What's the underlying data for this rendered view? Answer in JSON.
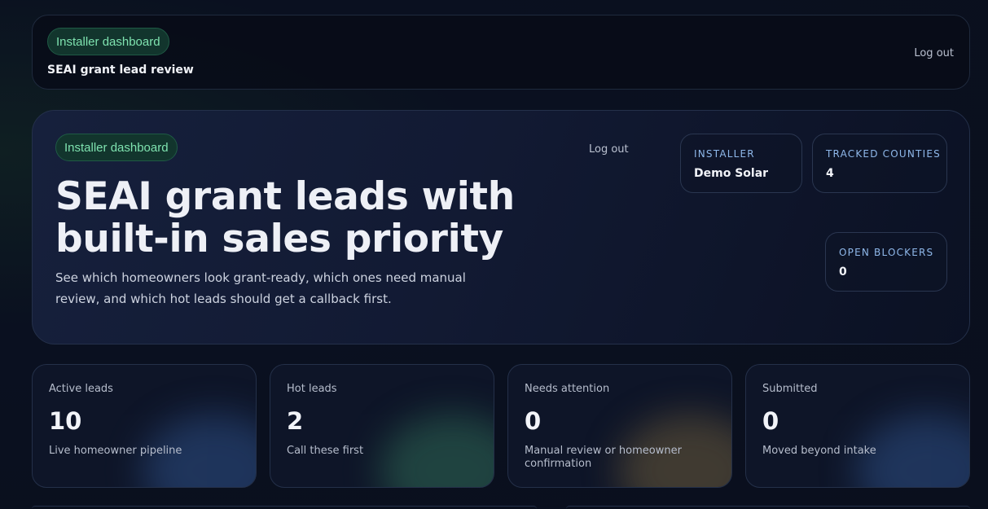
{
  "topbar": {
    "badge": "Installer dashboard",
    "subtitle": "SEAI grant lead review",
    "logout": "Log out"
  },
  "hero": {
    "badge": "Installer dashboard",
    "logout": "Log out",
    "title": "SEAI grant leads with built-in sales priority",
    "description": "See which homeowners look grant-ready, which ones need manual review, and which hot leads should get a callback first.",
    "stats": {
      "installer": {
        "label": "INSTALLER",
        "value": "Demo Solar"
      },
      "counties": {
        "label": "TRACKED COUNTIES",
        "value": "4"
      },
      "blockers": {
        "label": "OPEN BLOCKERS",
        "value": "0"
      }
    }
  },
  "cards": [
    {
      "title": "Active leads",
      "value": "10",
      "note": "Live homeowner pipeline",
      "glow": "#2d4f86"
    },
    {
      "title": "Hot leads",
      "value": "2",
      "note": "Call these first",
      "glow": "#2f6a55"
    },
    {
      "title": "Needs attention",
      "value": "0",
      "note": "Manual review or homeowner confirmation",
      "glow": "#6a5a3a"
    },
    {
      "title": "Submitted",
      "value": "0",
      "note": "Moved beyond intake",
      "glow": "#2d4f86"
    }
  ]
}
